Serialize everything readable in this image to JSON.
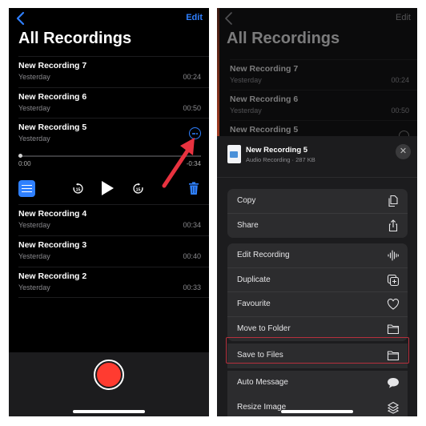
{
  "left_screen": {
    "nav": {
      "back_icon": "chevron-left-icon",
      "edit_label": "Edit"
    },
    "title": "All Recordings",
    "recordings": [
      {
        "name": "New Recording 7",
        "date": "Yesterday",
        "duration": "00:24"
      },
      {
        "name": "New Recording 6",
        "date": "Yesterday",
        "duration": "00:50"
      }
    ],
    "expanded_recording": {
      "name": "New Recording 5",
      "date": "Yesterday",
      "time_elapsed": "0:00",
      "time_remaining": "-0:34",
      "progress": 0,
      "more_icon": "ellipsis-circle-icon",
      "skip_back_label": "15",
      "skip_forward_label": "15",
      "controls": [
        "sliders-icon",
        "skip-back-15-icon",
        "play-icon",
        "skip-forward-15-icon",
        "trash-icon"
      ]
    },
    "recordings_after": [
      {
        "name": "New Recording 4",
        "date": "Yesterday",
        "duration": "00:34"
      },
      {
        "name": "New Recording 3",
        "date": "Yesterday",
        "duration": "00:40"
      },
      {
        "name": "New Recording 2",
        "date": "Yesterday",
        "duration": "00:33"
      }
    ],
    "annotation": "red-arrow-pointing-to-more-button",
    "record_button": "record-icon"
  },
  "right_screen": {
    "nav": {
      "back_icon": "chevron-left-icon",
      "edit_label": "Edit"
    },
    "title": "All Recordings",
    "recordings": [
      {
        "name": "New Recording 7",
        "date": "Yesterday",
        "duration": "00:24"
      },
      {
        "name": "New Recording 6",
        "date": "Yesterday",
        "duration": "00:50"
      },
      {
        "name": "New Recording 5",
        "date": "",
        "duration": ""
      }
    ],
    "share_sheet": {
      "file_name": "New Recording 5",
      "file_subtitle": "Audio Recording · 287 KB",
      "close_label": "✕",
      "group1": [
        {
          "label": "Copy",
          "icon": "copy-icon"
        },
        {
          "label": "Share",
          "icon": "share-icon"
        }
      ],
      "group2": [
        {
          "label": "Edit Recording",
          "icon": "waveform-icon"
        },
        {
          "label": "Duplicate",
          "icon": "duplicate-icon"
        },
        {
          "label": "Favourite",
          "icon": "heart-icon"
        },
        {
          "label": "Move to Folder",
          "icon": "folder-icon"
        }
      ],
      "group3": [
        {
          "label": "Save to Files",
          "icon": "folder-icon",
          "highlighted": true
        },
        {
          "label": "Auto Message",
          "icon": "message-bubble-icon"
        },
        {
          "label": "Resize Image",
          "icon": "layers-icon"
        }
      ],
      "highlight_color": "#b5303d"
    }
  },
  "colors": {
    "accent_blue": "#2f80ff",
    "record_red": "#ff3b30",
    "annotation_red": "#e8323f"
  }
}
